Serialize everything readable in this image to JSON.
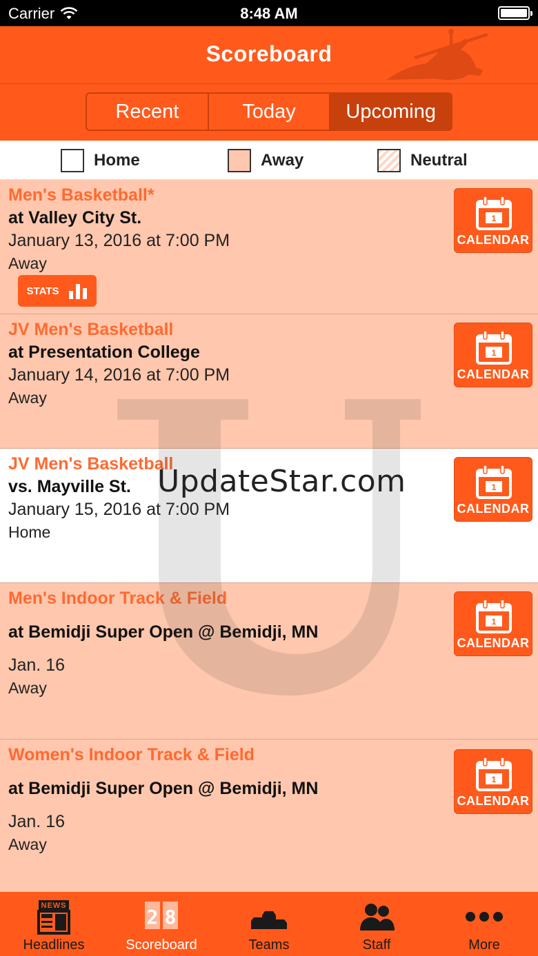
{
  "status_bar": {
    "carrier": "Carrier",
    "time": "8:48 AM"
  },
  "nav": {
    "title": "Scoreboard"
  },
  "segments": [
    {
      "label": "Recent",
      "active": false
    },
    {
      "label": "Today",
      "active": false
    },
    {
      "label": "Upcoming",
      "active": true
    }
  ],
  "legend": {
    "home": "Home",
    "away": "Away",
    "neutral": "Neutral"
  },
  "events": [
    {
      "sport": "Men's Basketball*",
      "opponent": "at Valley City St.",
      "date": "January 13, 2016 at 7:00 PM",
      "location": "Away",
      "type": "away",
      "calendar_label": "CALENDAR",
      "calendar_day": "1",
      "stats_label": "STATS"
    },
    {
      "sport": "JV Men's Basketball",
      "opponent": "at Presentation College",
      "date": "January 14, 2016 at 7:00 PM",
      "location": "Away",
      "type": "away",
      "calendar_label": "CALENDAR",
      "calendar_day": "1"
    },
    {
      "sport": "JV Men's Basketball",
      "opponent": "vs. Mayville St.",
      "date": "January 15, 2016 at 7:00 PM",
      "location": "Home",
      "type": "home",
      "calendar_label": "CALENDAR",
      "calendar_day": "1"
    },
    {
      "sport": "Men's Indoor Track & Field",
      "opponent": "at Bemidji Super Open @ Bemidji, MN",
      "date": "Jan. 16",
      "location": "Away",
      "type": "away",
      "calendar_label": "CALENDAR",
      "calendar_day": "1"
    },
    {
      "sport": "Women's Indoor Track & Field",
      "opponent": "at Bemidji Super Open @ Bemidji, MN",
      "date": "Jan. 16",
      "location": "Away",
      "type": "away",
      "calendar_label": "CALENDAR",
      "calendar_day": "1"
    }
  ],
  "watermark": {
    "text": "UpdateStar.com"
  },
  "tabs": [
    {
      "label": "Headlines",
      "icon": "news-icon",
      "active": false
    },
    {
      "label": "Scoreboard",
      "icon": "scoreboard-icon",
      "active": true,
      "icon_text": "28"
    },
    {
      "label": "Teams",
      "icon": "podium-icon",
      "active": false
    },
    {
      "label": "Staff",
      "icon": "people-icon",
      "active": false
    },
    {
      "label": "More",
      "icon": "more-dots-icon",
      "active": false
    }
  ],
  "icon_texts": {
    "news": "NEWS"
  },
  "colors": {
    "accent": "#ff5a1c",
    "accent_dark": "#c8400c",
    "away_row": "#ffc7ad",
    "sport_text": "#ff6a30"
  }
}
